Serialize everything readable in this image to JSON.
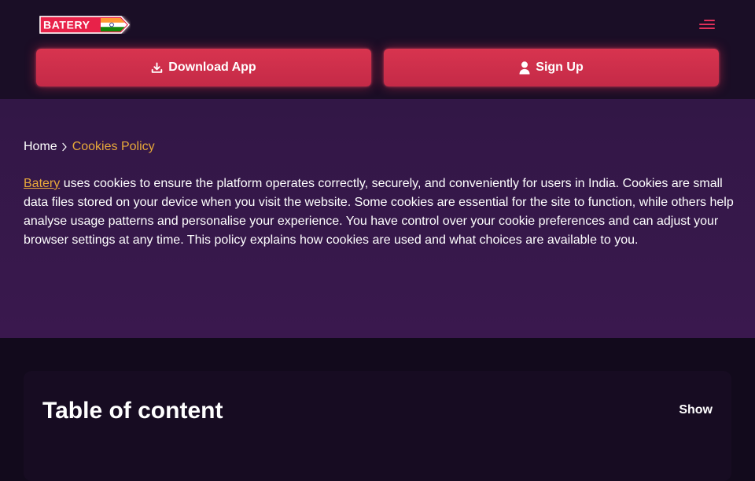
{
  "header": {
    "logo": {
      "text": "BATERY",
      "flag": "india-flag-icon",
      "colors": {
        "badge": "#e8204a",
        "saffron": "#ff9933",
        "green": "#138808",
        "white": "#ffffff"
      }
    },
    "menu_icon": "hamburger-menu-icon",
    "download_button": {
      "label": "Download App",
      "icon": "download-icon"
    },
    "signup_button": {
      "label": "Sign Up",
      "icon": "user-icon"
    }
  },
  "breadcrumb": {
    "home": "Home",
    "separator_icon": "chevron-right-icon",
    "current": "Cookies Policy"
  },
  "intro": {
    "brand_link": "Batery",
    "text": " uses cookies to ensure the platform operates correctly, securely, and conveniently for users in India. Cookies are small data files stored on your device when you visit the website. Some cookies are essential for the site to function, while others help analyse usage patterns and personalise your experience. You have control over your cookie preferences and can adjust your browser settings at any time. This policy explains how cookies are used and what choices are available to you."
  },
  "toc": {
    "title": "Table of content",
    "toggle_label": "Show"
  },
  "colors": {
    "accent": "#d8344f",
    "link": "#e8a93a",
    "header_bg": "#1a0e26",
    "intro_bg": "#351848",
    "page_bg": "#120a1c"
  }
}
